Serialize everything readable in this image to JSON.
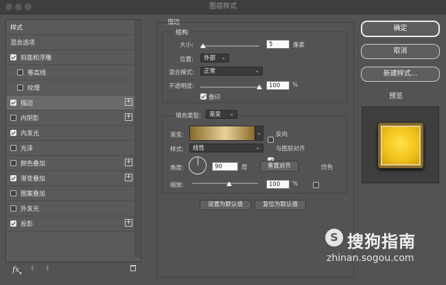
{
  "window": {
    "title": "图层样式"
  },
  "styles_list": {
    "header": "样式",
    "items": [
      {
        "label": "混合选项",
        "checkbox": false,
        "checked": false,
        "plus": false,
        "indent": false,
        "selected": false
      },
      {
        "label": "斜面和浮雕",
        "checkbox": true,
        "checked": true,
        "plus": false,
        "indent": false,
        "selected": false
      },
      {
        "label": "等高线",
        "checkbox": true,
        "checked": false,
        "plus": false,
        "indent": true,
        "selected": false
      },
      {
        "label": "纹理",
        "checkbox": true,
        "checked": false,
        "plus": false,
        "indent": true,
        "selected": false
      },
      {
        "label": "描边",
        "checkbox": true,
        "checked": true,
        "plus": true,
        "indent": false,
        "selected": true
      },
      {
        "label": "内阴影",
        "checkbox": true,
        "checked": false,
        "plus": true,
        "indent": false,
        "selected": false
      },
      {
        "label": "内发光",
        "checkbox": true,
        "checked": true,
        "plus": false,
        "indent": false,
        "selected": false
      },
      {
        "label": "光泽",
        "checkbox": true,
        "checked": false,
        "plus": false,
        "indent": false,
        "selected": false
      },
      {
        "label": "颜色叠加",
        "checkbox": true,
        "checked": false,
        "plus": true,
        "indent": false,
        "selected": false
      },
      {
        "label": "渐变叠加",
        "checkbox": true,
        "checked": true,
        "plus": true,
        "indent": false,
        "selected": false
      },
      {
        "label": "图案叠加",
        "checkbox": true,
        "checked": false,
        "plus": false,
        "indent": false,
        "selected": false
      },
      {
        "label": "外发光",
        "checkbox": true,
        "checked": false,
        "plus": false,
        "indent": false,
        "selected": false
      },
      {
        "label": "投影",
        "checkbox": true,
        "checked": true,
        "plus": true,
        "indent": false,
        "selected": false
      }
    ],
    "fx_label": "fx"
  },
  "stroke": {
    "section_title": "描边",
    "structure_title": "结构",
    "size_label": "大小:",
    "size_value": "5",
    "size_unit": "像素",
    "position_label": "位置:",
    "position_value": "外部",
    "blend_label": "混合模式:",
    "blend_value": "正常",
    "opacity_label": "不透明度:",
    "opacity_value": "100",
    "opacity_unit": "%",
    "overprint_label": "叠印",
    "overprint_checked": true,
    "fill_type_label": "填充类型:",
    "fill_type_value": "渐变",
    "gradient_label": "渐变:",
    "reverse_label": "反向",
    "reverse_checked": false,
    "style_label": "样式:",
    "style_value": "线性",
    "align_label": "与图层对齐",
    "align_checked": true,
    "angle_label": "角度:",
    "angle_value": "90",
    "angle_unit": "度",
    "reset_align_label": "重置对齐",
    "dither_label": "仿色",
    "dither_checked": false,
    "scale_label": "缩放:",
    "scale_value": "100",
    "scale_unit": "%",
    "set_default_label": "设置为默认值",
    "reset_default_label": "复位为默认值"
  },
  "actions": {
    "ok_label": "确定",
    "cancel_label": "取消",
    "new_style_label": "新建样式...",
    "preview_label": "预览",
    "preview_checked": true
  },
  "watermark": {
    "brand": "搜狗指南",
    "url": "zhinan.sogou.com"
  },
  "colors": {
    "panel_bg": "#535353",
    "gradient_stops": [
      "#8a6a2c",
      "#e9d29a",
      "#8a6a2c"
    ],
    "preview_gold": "#f2c318"
  }
}
